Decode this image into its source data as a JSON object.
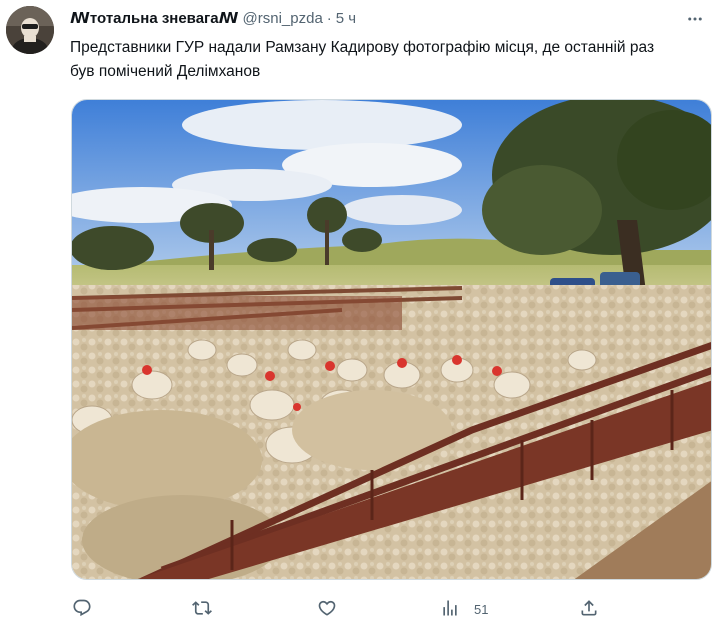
{
  "tweet": {
    "display_name": "ꟿтотальна зневагаꟿ",
    "handle": "@rsni_pzda",
    "separator": "·",
    "time": "5 ч",
    "text": "Представники ГУР надали Рамзану Кадирову фотографію місця, де останній раз був помічений Делімханов",
    "media": {
      "description_icon": "photo-sheep-in-pen",
      "colors": {
        "sky": "#5a8fd6",
        "grass": "#c8c98a",
        "fence": "#7a3b2a",
        "wool": "#d8c7a8"
      }
    }
  },
  "actions": {
    "reply": {
      "icon": "reply-icon",
      "count": ""
    },
    "retweet": {
      "icon": "retweet-icon",
      "count": ""
    },
    "like": {
      "icon": "like-icon",
      "count": ""
    },
    "views": {
      "icon": "views-icon",
      "count": "51"
    },
    "share": {
      "icon": "share-icon",
      "count": ""
    }
  },
  "theme": {
    "text": "#0f1419",
    "muted": "#536471",
    "border": "#cfd9de"
  }
}
